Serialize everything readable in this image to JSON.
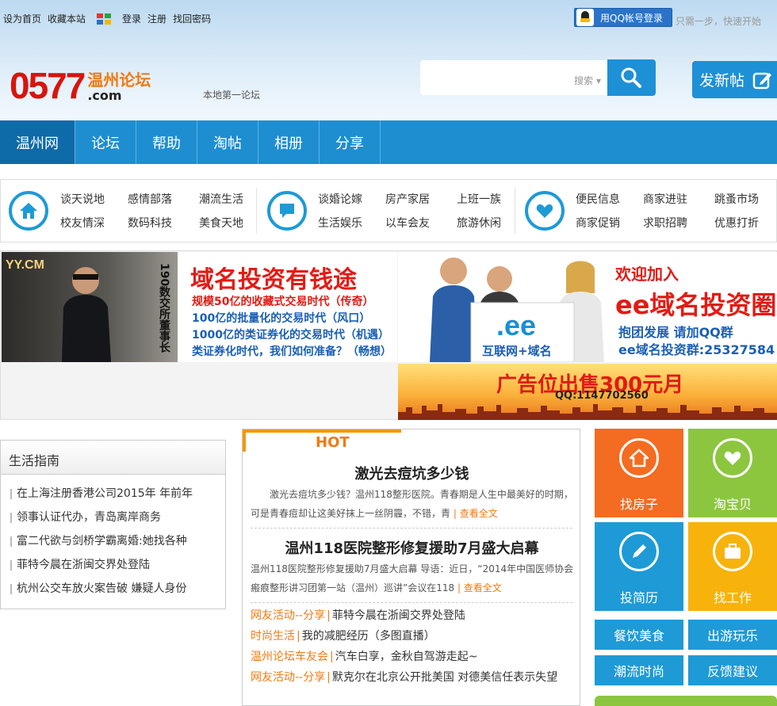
{
  "topbar": {
    "links": [
      "设为首页",
      "收藏本站"
    ],
    "auth": [
      "登录",
      "注册",
      "找回密码"
    ],
    "qq_login": "用QQ帐号登录",
    "qq_hint": "只需一步，快速开始"
  },
  "header": {
    "logo_num": "0577",
    "logo_cn": "温州论坛",
    "logo_com": ".com",
    "slogan": "本地第一论坛",
    "search_label": "搜索",
    "post_button": "发新帖"
  },
  "nav": {
    "items": [
      "温州网",
      "论坛",
      "帮助",
      "淘帖",
      "相册",
      "分享"
    ]
  },
  "categories": {
    "group1": [
      "谈天说地",
      "感情部落",
      "潮流生活",
      "校友情深",
      "数码科技",
      "美食天地"
    ],
    "group2": [
      "谈婚论嫁",
      "房产家居",
      "上班一族",
      "生活娱乐",
      "以车会友",
      "旅游休闲"
    ],
    "group3": [
      "便民信息",
      "商家进驻",
      "跳蚤市场",
      "商家促销",
      "求职招聘",
      "优惠打折"
    ]
  },
  "banners": {
    "b1_brand": "YY.CM",
    "b1_vertical": "190数交所董事长",
    "b1_title": "域名投资有钱途",
    "b1_lines": [
      "规模50亿的收藏式交易时代（传奇）",
      "100亿的批量化的交易时代（风口）",
      "1000亿的类证券化的交易时代（机遇）",
      "类证券化时代，我们如何准备？（畅想）"
    ],
    "b2_sign_ee": ".ee",
    "b2_sign_text": "互联网+域名",
    "b2_title1": "欢迎加入",
    "b2_title2": "ee域名投资圈",
    "b2_line3": "抱团发展 请加QQ群",
    "b2_line4": "ee域名投资群:25327584",
    "b3_title": "广告位出售300元月",
    "b3_qq": "QQ:1147702560"
  },
  "guide": {
    "title": "生活指南",
    "items": [
      "在上海注册香港公司2015年 年前年",
      "领事认证代办，青岛离岸商务",
      "富二代欲与剑桥学霸离婚:她找各种",
      "菲特今晨在浙闽交界处登陆",
      "杭州公交车放火案告破 嫌疑人身份"
    ]
  },
  "hot": {
    "label": "HOT",
    "article1": {
      "title": "激光去痘坑多少钱",
      "desc": "激光去痘坑多少钱？温州118整形医院。青春期是人生中最美好的时期，可是青春痘却让这美好抹上一丝阴霾，不错，青",
      "more": "查看全文"
    },
    "article2": {
      "title": "温州118医院整形修复援助7月盛大启幕",
      "desc": "温州118医院整形修复援助7月盛大启幕 导语：近日，“2014年中国医师协会瘢痕整形讲习团第一站（温州）巡讲”会议在118",
      "more": "查看全文"
    },
    "lines": [
      {
        "tag": "网友活动--分享",
        "text": "菲特今晨在浙闽交界处登陆"
      },
      {
        "tag": "时尚生活",
        "text": "我的减肥经历（多图直播）"
      },
      {
        "tag": "温州论坛车友会",
        "text": "汽车白享，金秋自驾游走起~"
      },
      {
        "tag": "网友活动--分享",
        "text": "默克尔在北京公开批美国 对德美信任表示失望"
      }
    ]
  },
  "tiles": {
    "big": [
      "找房子",
      "淘宝贝",
      "投简历",
      "找工作"
    ],
    "small": [
      "餐饮美食",
      "出游玩乐",
      "潮流时尚",
      "反馈建议"
    ],
    "colors": {
      "orange": "#f36c21",
      "green": "#8cc63f",
      "blue": "#1e9ad6",
      "yellow": "#f7b30b"
    }
  }
}
